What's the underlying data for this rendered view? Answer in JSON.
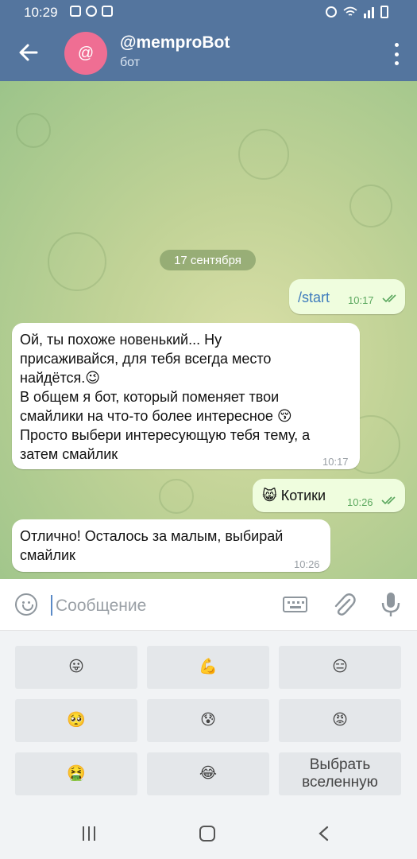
{
  "status_bar": {
    "time": "10:29"
  },
  "header": {
    "title": "@memproBot",
    "subtitle": "бот",
    "avatar_letter": "@",
    "avatar_color": "#ef6e93"
  },
  "chat": {
    "date_chip": "17 сентября",
    "messages": [
      {
        "direction": "out",
        "text": "/start",
        "time": "10:17",
        "read": true
      },
      {
        "direction": "in",
        "lines": [
          "Ой, ты похоже новенький... Ну",
          "присаживайся, для тебя всегда место",
          "найдётся.😉",
          "В общем я бот, который поменяет твои",
          "смайлики на что-то более интересное 😚",
          "Просто выбери интересующую тебя тему, а",
          "затем смайлик"
        ],
        "time": "10:17"
      },
      {
        "direction": "out",
        "text": "😸 Котики",
        "time": "10:26",
        "read": true
      },
      {
        "direction": "in",
        "lines": [
          "Отлично! Осталось за малым, выбирай",
          "смайлик"
        ],
        "time": "10:26"
      }
    ]
  },
  "input": {
    "placeholder": "Сообщение",
    "value": ""
  },
  "keyboard": {
    "rows": [
      [
        {
          "label": "😛",
          "icon": "tongue-emoji"
        },
        {
          "label": "💪",
          "icon": "muscle-emoji"
        },
        {
          "label": "😑",
          "icon": "expressionless-emoji"
        }
      ],
      [
        {
          "label": "🥺",
          "icon": "pleading-emoji"
        },
        {
          "label": "😰",
          "icon": "anxious-emoji"
        },
        {
          "label": "😡",
          "icon": "angry-emoji"
        }
      ],
      [
        {
          "label": "🤮",
          "icon": "vomiting-emoji"
        },
        {
          "label": "😂",
          "icon": "tears-of-joy-emoji"
        },
        {
          "label": "Выбрать вселенную"
        }
      ]
    ]
  },
  "colors": {
    "header": "#54759e",
    "out_bubble": "#effdde",
    "in_bubble": "#ffffff",
    "check": "#5ca85f"
  }
}
